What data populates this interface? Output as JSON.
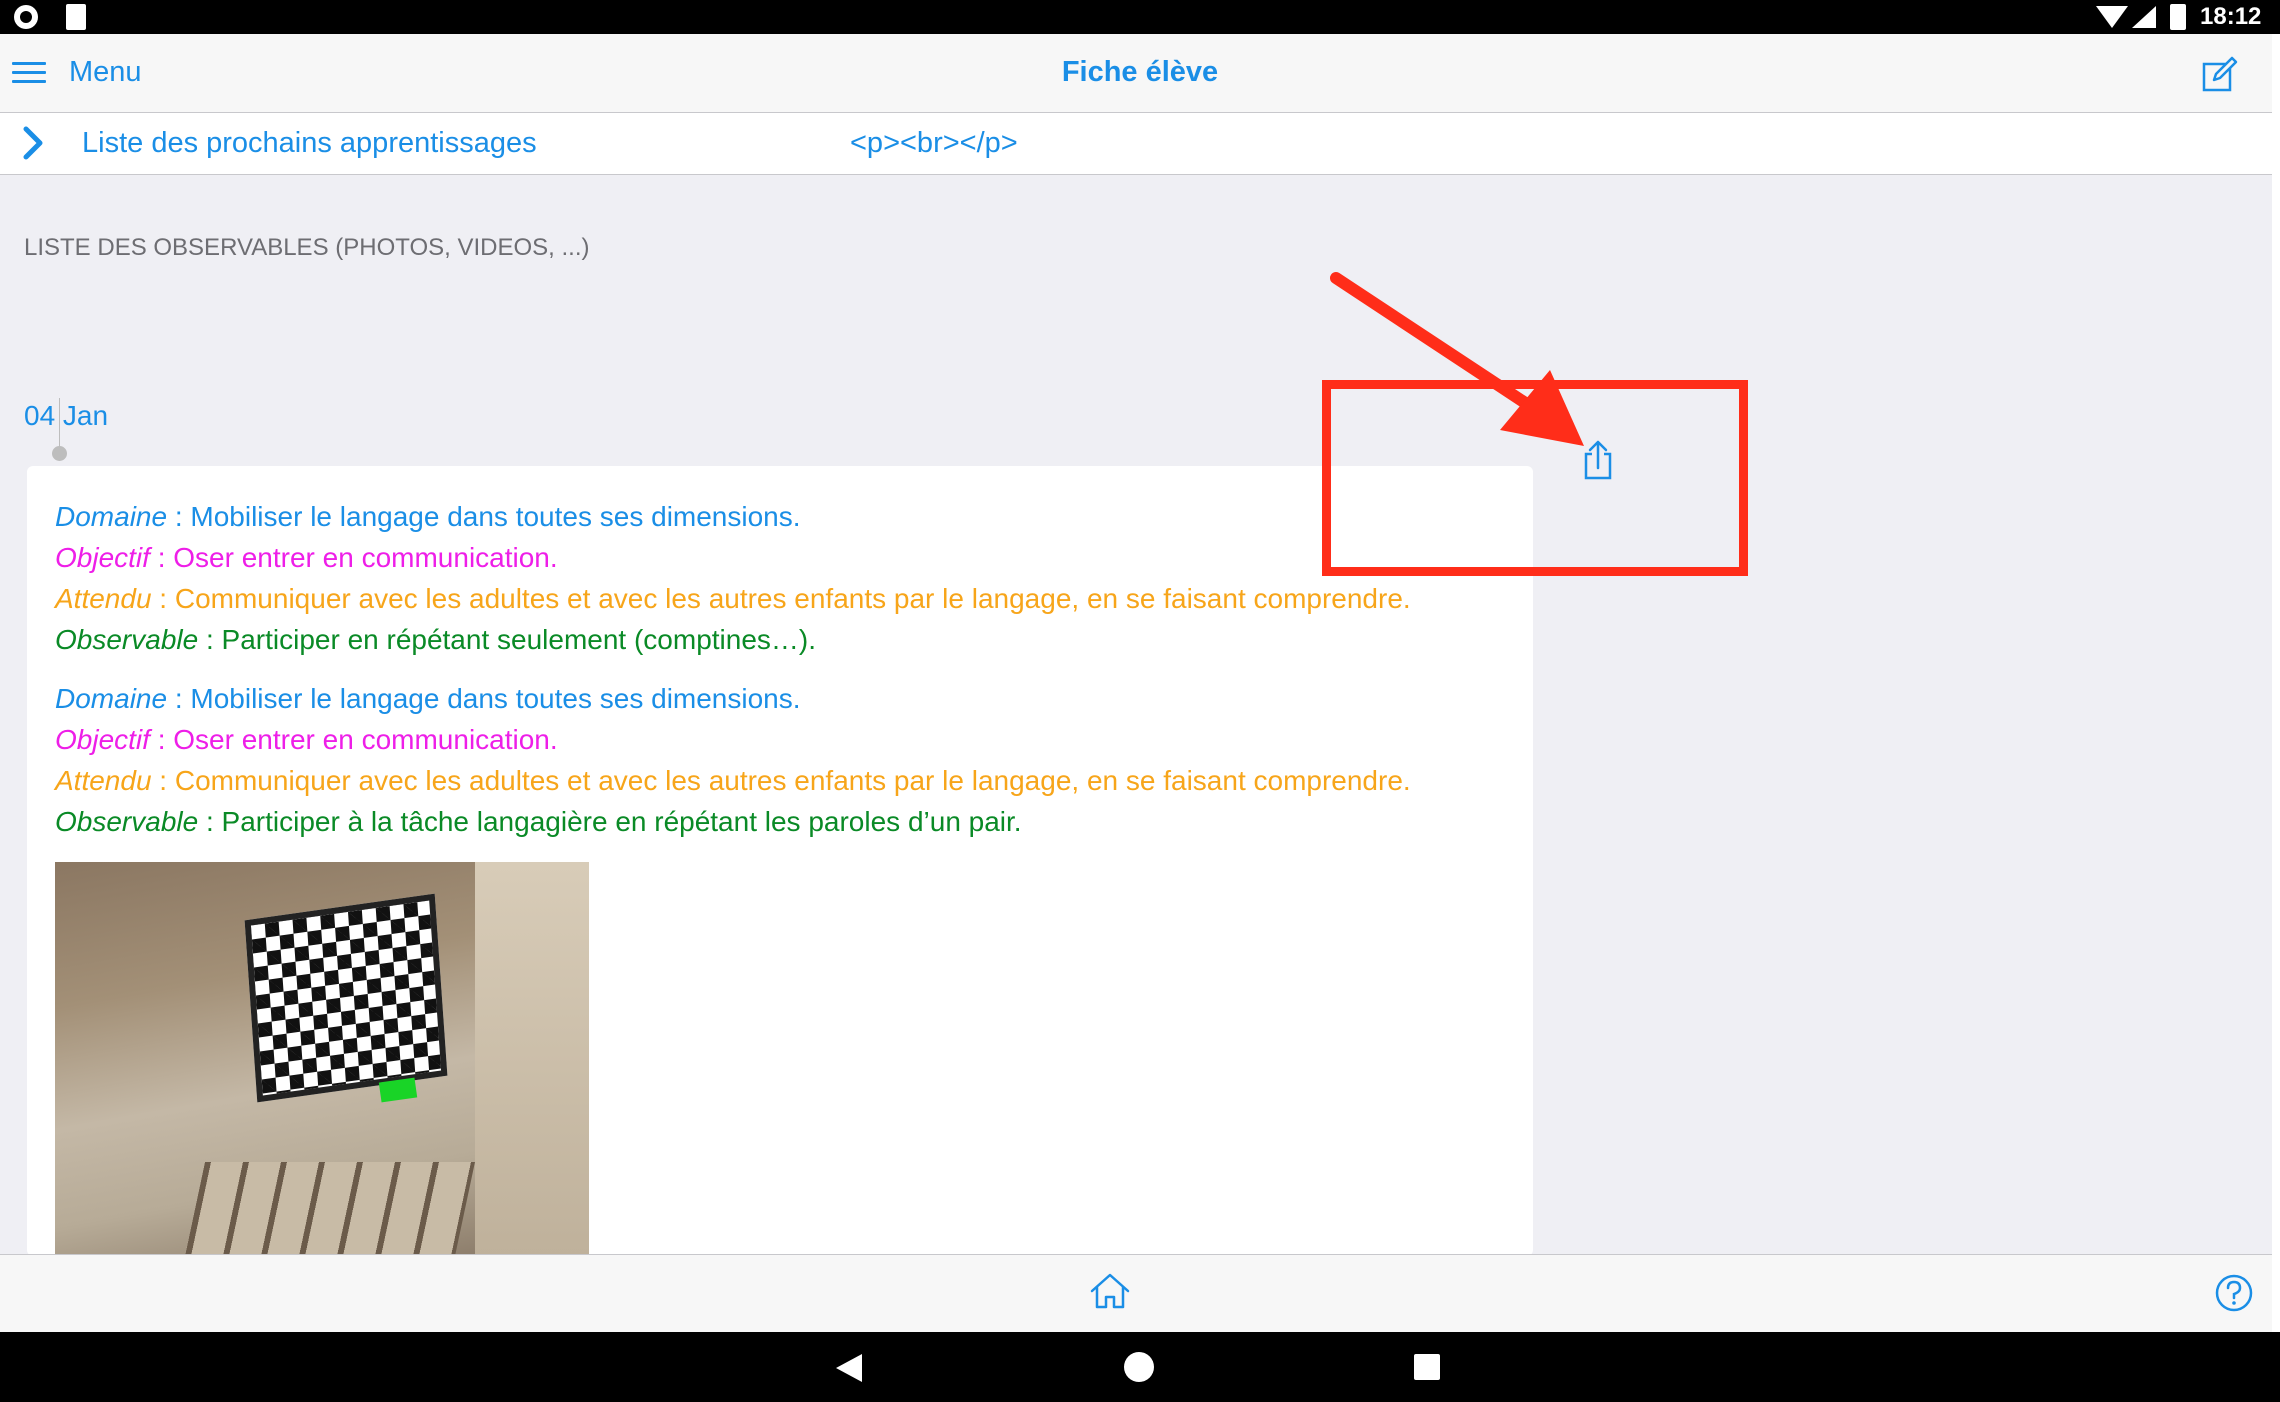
{
  "status_bar": {
    "time": "18:12"
  },
  "nav": {
    "menu_label": "Menu",
    "title": "Fiche élève"
  },
  "next_learning": {
    "label": "Liste des prochains apprentissages",
    "value": "<p><br></p>"
  },
  "section_title": "LISTE DES OBSERVABLES (PHOTOS, VIDEOS, ...)",
  "date": "04 Jan",
  "labels": {
    "domaine": "Domaine",
    "objectif": "Objectif",
    "attendu": "Attendu",
    "observable": "Observable"
  },
  "entries": [
    {
      "domaine": " : Mobiliser le langage dans toutes ses dimensions.",
      "objectif": " : Oser entrer en communication.",
      "attendu": " : Communiquer avec les adultes et avec les autres enfants par le langage, en se faisant comprendre.",
      "observable": " : Participer en répétant seulement (comptines…)."
    },
    {
      "domaine": " : Mobiliser le langage dans toutes ses dimensions.",
      "objectif": " : Oser entrer en communication.",
      "attendu": " : Communiquer avec les adultes et avec les autres enfants par le langage, en se faisant comprendre.",
      "observable": " : Participer à la tâche langagière en répétant les paroles d’un pair."
    }
  ],
  "colors": {
    "accent": "#1a8ee6",
    "objectif": "#ee1ee8",
    "attendu": "#f7a51a",
    "observable": "#0a8a26",
    "annotation": "#ff2d19"
  },
  "icons": [
    "menu-icon",
    "edit-icon",
    "chevron-right-icon",
    "share-icon",
    "home-icon",
    "help-icon"
  ]
}
